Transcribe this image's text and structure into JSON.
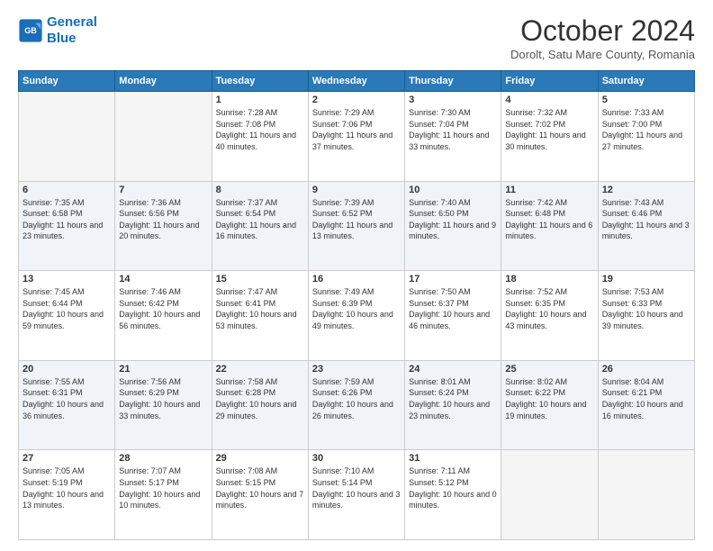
{
  "header": {
    "logo_line1": "General",
    "logo_line2": "Blue",
    "month": "October 2024",
    "location": "Dorolt, Satu Mare County, Romania"
  },
  "weekdays": [
    "Sunday",
    "Monday",
    "Tuesday",
    "Wednesday",
    "Thursday",
    "Friday",
    "Saturday"
  ],
  "weeks": [
    [
      {
        "day": "",
        "info": ""
      },
      {
        "day": "",
        "info": ""
      },
      {
        "day": "1",
        "info": "Sunrise: 7:28 AM\nSunset: 7:08 PM\nDaylight: 11 hours and 40 minutes."
      },
      {
        "day": "2",
        "info": "Sunrise: 7:29 AM\nSunset: 7:06 PM\nDaylight: 11 hours and 37 minutes."
      },
      {
        "day": "3",
        "info": "Sunrise: 7:30 AM\nSunset: 7:04 PM\nDaylight: 11 hours and 33 minutes."
      },
      {
        "day": "4",
        "info": "Sunrise: 7:32 AM\nSunset: 7:02 PM\nDaylight: 11 hours and 30 minutes."
      },
      {
        "day": "5",
        "info": "Sunrise: 7:33 AM\nSunset: 7:00 PM\nDaylight: 11 hours and 27 minutes."
      }
    ],
    [
      {
        "day": "6",
        "info": "Sunrise: 7:35 AM\nSunset: 6:58 PM\nDaylight: 11 hours and 23 minutes."
      },
      {
        "day": "7",
        "info": "Sunrise: 7:36 AM\nSunset: 6:56 PM\nDaylight: 11 hours and 20 minutes."
      },
      {
        "day": "8",
        "info": "Sunrise: 7:37 AM\nSunset: 6:54 PM\nDaylight: 11 hours and 16 minutes."
      },
      {
        "day": "9",
        "info": "Sunrise: 7:39 AM\nSunset: 6:52 PM\nDaylight: 11 hours and 13 minutes."
      },
      {
        "day": "10",
        "info": "Sunrise: 7:40 AM\nSunset: 6:50 PM\nDaylight: 11 hours and 9 minutes."
      },
      {
        "day": "11",
        "info": "Sunrise: 7:42 AM\nSunset: 6:48 PM\nDaylight: 11 hours and 6 minutes."
      },
      {
        "day": "12",
        "info": "Sunrise: 7:43 AM\nSunset: 6:46 PM\nDaylight: 11 hours and 3 minutes."
      }
    ],
    [
      {
        "day": "13",
        "info": "Sunrise: 7:45 AM\nSunset: 6:44 PM\nDaylight: 10 hours and 59 minutes."
      },
      {
        "day": "14",
        "info": "Sunrise: 7:46 AM\nSunset: 6:42 PM\nDaylight: 10 hours and 56 minutes."
      },
      {
        "day": "15",
        "info": "Sunrise: 7:47 AM\nSunset: 6:41 PM\nDaylight: 10 hours and 53 minutes."
      },
      {
        "day": "16",
        "info": "Sunrise: 7:49 AM\nSunset: 6:39 PM\nDaylight: 10 hours and 49 minutes."
      },
      {
        "day": "17",
        "info": "Sunrise: 7:50 AM\nSunset: 6:37 PM\nDaylight: 10 hours and 46 minutes."
      },
      {
        "day": "18",
        "info": "Sunrise: 7:52 AM\nSunset: 6:35 PM\nDaylight: 10 hours and 43 minutes."
      },
      {
        "day": "19",
        "info": "Sunrise: 7:53 AM\nSunset: 6:33 PM\nDaylight: 10 hours and 39 minutes."
      }
    ],
    [
      {
        "day": "20",
        "info": "Sunrise: 7:55 AM\nSunset: 6:31 PM\nDaylight: 10 hours and 36 minutes."
      },
      {
        "day": "21",
        "info": "Sunrise: 7:56 AM\nSunset: 6:29 PM\nDaylight: 10 hours and 33 minutes."
      },
      {
        "day": "22",
        "info": "Sunrise: 7:58 AM\nSunset: 6:28 PM\nDaylight: 10 hours and 29 minutes."
      },
      {
        "day": "23",
        "info": "Sunrise: 7:59 AM\nSunset: 6:26 PM\nDaylight: 10 hours and 26 minutes."
      },
      {
        "day": "24",
        "info": "Sunrise: 8:01 AM\nSunset: 6:24 PM\nDaylight: 10 hours and 23 minutes."
      },
      {
        "day": "25",
        "info": "Sunrise: 8:02 AM\nSunset: 6:22 PM\nDaylight: 10 hours and 19 minutes."
      },
      {
        "day": "26",
        "info": "Sunrise: 8:04 AM\nSunset: 6:21 PM\nDaylight: 10 hours and 16 minutes."
      }
    ],
    [
      {
        "day": "27",
        "info": "Sunrise: 7:05 AM\nSunset: 5:19 PM\nDaylight: 10 hours and 13 minutes."
      },
      {
        "day": "28",
        "info": "Sunrise: 7:07 AM\nSunset: 5:17 PM\nDaylight: 10 hours and 10 minutes."
      },
      {
        "day": "29",
        "info": "Sunrise: 7:08 AM\nSunset: 5:15 PM\nDaylight: 10 hours and 7 minutes."
      },
      {
        "day": "30",
        "info": "Sunrise: 7:10 AM\nSunset: 5:14 PM\nDaylight: 10 hours and 3 minutes."
      },
      {
        "day": "31",
        "info": "Sunrise: 7:11 AM\nSunset: 5:12 PM\nDaylight: 10 hours and 0 minutes."
      },
      {
        "day": "",
        "info": ""
      },
      {
        "day": "",
        "info": ""
      }
    ]
  ]
}
